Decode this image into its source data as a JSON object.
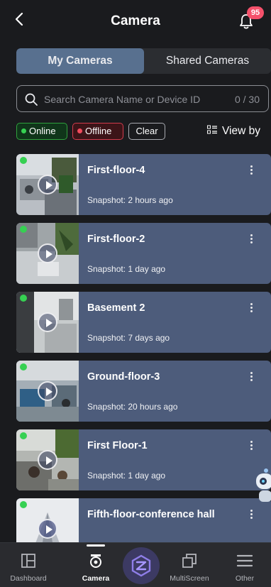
{
  "header": {
    "title": "Camera",
    "notification_count": "95"
  },
  "segments": {
    "my_cameras": "My Cameras",
    "shared_cameras": "Shared Cameras"
  },
  "search": {
    "placeholder": "Search Camera Name or Device ID",
    "count": "0 / 30"
  },
  "filters": {
    "online": "Online",
    "offline": "Offline",
    "clear": "Clear",
    "view_by": "View by"
  },
  "cameras": [
    {
      "name": "First-floor-4",
      "snapshot": "Snapshot: 2 hours ago"
    },
    {
      "name": "First-floor-2",
      "snapshot": "Snapshot: 1 day ago"
    },
    {
      "name": "Basement 2",
      "snapshot": "Snapshot: 7 days ago"
    },
    {
      "name": "Ground-floor-3",
      "snapshot": "Snapshot: 20 hours ago"
    },
    {
      "name": "First Floor-1",
      "snapshot": "Snapshot: 1 day ago"
    },
    {
      "name": "Fifth-floor-conference hall",
      "snapshot": ""
    }
  ],
  "nav": {
    "dashboard": "Dashboard",
    "camera": "Camera",
    "multiscreen": "MultiScreen",
    "other": "Other"
  },
  "colors": {
    "accent": "#58708f",
    "card": "#4d5c7b",
    "online": "#36d052",
    "offline": "#f14b5d",
    "badge": "#f5516b"
  }
}
